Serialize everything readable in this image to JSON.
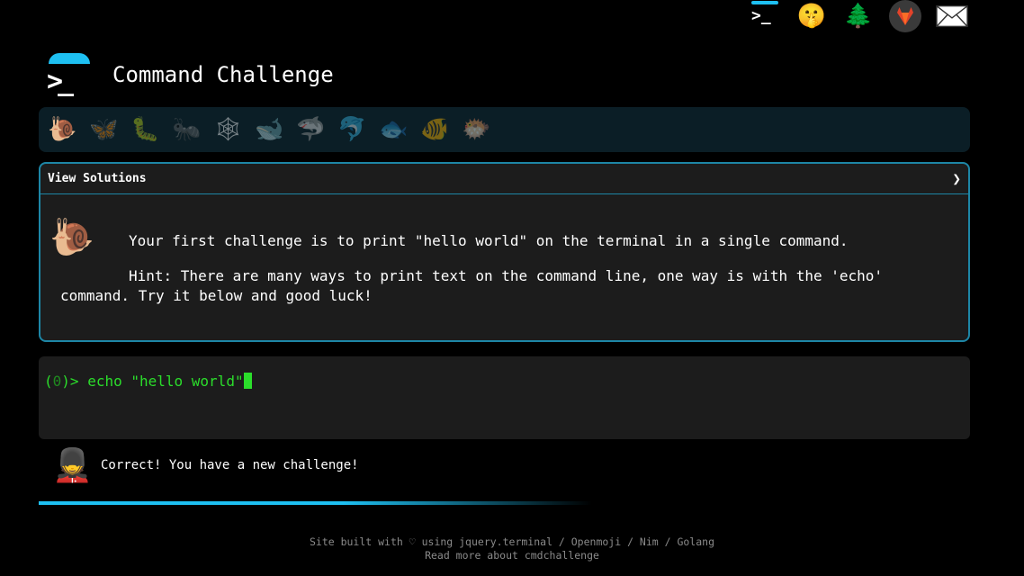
{
  "topbar": {
    "icons": [
      "terminal-icon",
      "shushing-face-icon",
      "tree-icon",
      "gitlab-icon",
      "mail-icon"
    ]
  },
  "header": {
    "title": "Command Challenge"
  },
  "levels": [
    {
      "name": "snail",
      "glyph": "🐌"
    },
    {
      "name": "butterfly",
      "glyph": "🦋"
    },
    {
      "name": "caterpillar",
      "glyph": "🐛"
    },
    {
      "name": "ant",
      "glyph": "🐜"
    },
    {
      "name": "spider-web",
      "glyph": "🕸"
    },
    {
      "name": "whale",
      "glyph": "🐋"
    },
    {
      "name": "shark",
      "glyph": "🦈"
    },
    {
      "name": "dolphin",
      "glyph": "🐬"
    },
    {
      "name": "fish",
      "glyph": "🐟"
    },
    {
      "name": "tropical-fish",
      "glyph": "🐠"
    },
    {
      "name": "blowfish",
      "glyph": "🐡"
    }
  ],
  "panel": {
    "header_label": "View Solutions",
    "arrow": "❯",
    "challenge_text": "Your first challenge is to print \"hello world\" on the terminal in a single command.",
    "hint_text": "Hint: There are many ways to print text on the command line, one way is with the 'echo' command. Try it below and good luck!"
  },
  "terminal": {
    "prompt_open": "(",
    "exit_code": "0",
    "prompt_close": ")> ",
    "command": "echo \"hello world\""
  },
  "status": {
    "message": "Correct! You have a new challenge!"
  },
  "progress": {
    "fraction": 0.55
  },
  "footer": {
    "line1": "Site built with ♡ using jquery.terminal / Openmoji / Nim / Golang",
    "line2": "Read more about cmdchallenge"
  },
  "colors": {
    "accent": "#1ec0f2",
    "border": "#1d86a6",
    "prompt": "#2bdd2b",
    "panel_bg": "#1c1c1c",
    "levels_bg": "#0b1e26"
  }
}
